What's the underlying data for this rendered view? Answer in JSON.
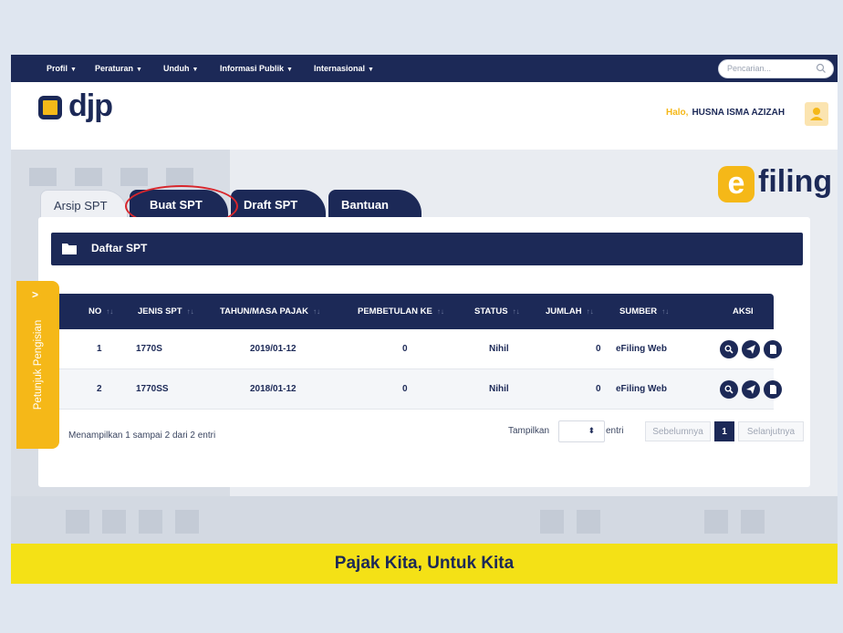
{
  "nav": {
    "items": [
      {
        "label": "Profil"
      },
      {
        "label": "Peraturan"
      },
      {
        "label": "Unduh"
      },
      {
        "label": "Informasi Publik"
      },
      {
        "label": "Internasional"
      }
    ],
    "search_placeholder": "Pencarian..."
  },
  "header": {
    "logo_text": "djp",
    "greeting": "Halo,",
    "user_name": "HUSNA ISMA AZIZAH"
  },
  "brand": {
    "efiling_e": "e",
    "efiling_text": "filing"
  },
  "tabs": [
    {
      "label": "Arsip SPT",
      "active": false
    },
    {
      "label": "Buat SPT",
      "active": false
    },
    {
      "label": "Draft SPT",
      "active": false
    },
    {
      "label": "Bantuan",
      "active": false
    }
  ],
  "panel": {
    "title": "Daftar SPT",
    "columns": [
      "NO",
      "JENIS SPT",
      "TAHUN/MASA PAJAK",
      "PEMBETULAN KE",
      "STATUS",
      "JUMLAH",
      "SUMBER",
      "AKSI"
    ],
    "rows": [
      {
        "no": "1",
        "jenis": "1770S",
        "tahun": "2019/01-12",
        "pembetulan": "0",
        "status": "Nihil",
        "jumlah": "0",
        "sumber": "eFiling Web"
      },
      {
        "no": "2",
        "jenis": "1770SS",
        "tahun": "2018/01-12",
        "pembetulan": "0",
        "status": "Nihil",
        "jumlah": "0",
        "sumber": "eFiling Web"
      }
    ],
    "info": "Menampilkan 1 sampai 2 dari 2 entri",
    "show_label": "Tampilkan",
    "entries_label": "entri",
    "prev": "Sebelumnya",
    "page": "1",
    "next": "Selanjutnya"
  },
  "side_tab": {
    "chevron": ">",
    "label": "Petunjuk Pengisian"
  },
  "footer": {
    "slogan": "Pajak Kita, Untuk Kita"
  },
  "colors": {
    "navy": "#1c2957",
    "yellow": "#f5b818",
    "footer_yellow": "#f4e116",
    "highlight_red": "#d8262c"
  }
}
